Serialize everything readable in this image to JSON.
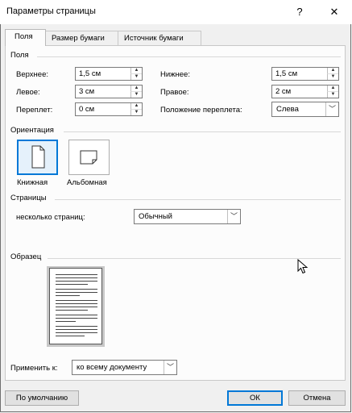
{
  "window": {
    "title": "Параметры страницы",
    "help_glyph": "?",
    "close_glyph": "✕"
  },
  "tabs": [
    {
      "label": "Поля",
      "active": true
    },
    {
      "label": "Размер бумаги",
      "active": false
    },
    {
      "label": "Источник бумаги",
      "active": false
    }
  ],
  "margins": {
    "group_label": "Поля",
    "top_label": "Верхнее:",
    "top_value": "1,5 см",
    "bottom_label": "Нижнее:",
    "bottom_value": "1,5 см",
    "left_label": "Левое:",
    "left_value": "3 см",
    "right_label": "Правое:",
    "right_value": "2 см",
    "gutter_label": "Переплет:",
    "gutter_value": "0 см",
    "gutter_pos_label": "Положение переплета:",
    "gutter_pos_value": "Слева"
  },
  "orientation": {
    "group_label": "Ориентация",
    "portrait_label": "Книжная",
    "landscape_label": "Альбомная",
    "selected": "portrait"
  },
  "pages": {
    "group_label": "Страницы",
    "multiple_label": "несколько страниц:",
    "multiple_value": "Обычный"
  },
  "preview": {
    "group_label": "Образец"
  },
  "apply": {
    "label": "Применить к:",
    "value": "ко всему документу"
  },
  "footer": {
    "default_label": "По умолчанию",
    "ok_label": "ОК",
    "cancel_label": "Отмена"
  },
  "icons": {
    "dropdown": "chevron-down-icon",
    "spin_up": "spin-up-icon",
    "spin_down": "spin-down-icon"
  },
  "colors": {
    "accent": "#0078d7",
    "background": "#f0f0f0",
    "panel": "#fcfcfc"
  }
}
